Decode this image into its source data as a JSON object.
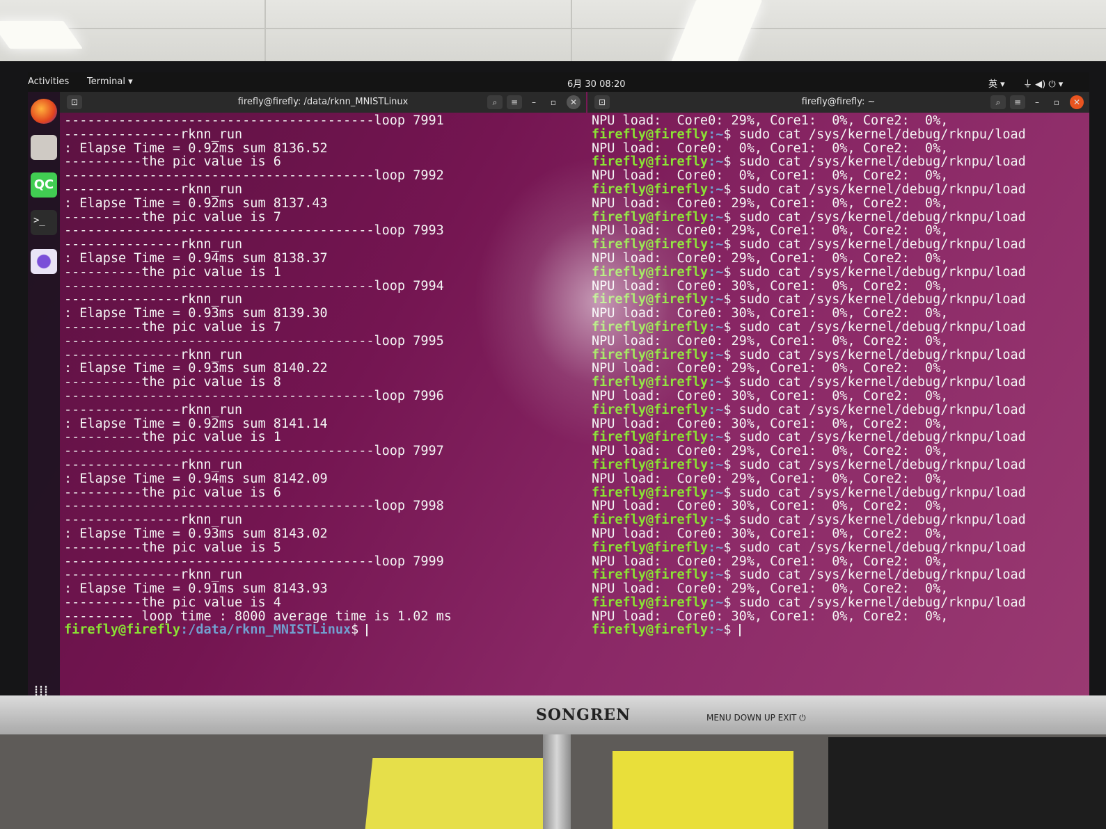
{
  "topbar": {
    "activities": "Activities",
    "terminal_menu": "Terminal ▾",
    "clock": "6月 30 08:20",
    "input_method": "英 ▾"
  },
  "left_terminal": {
    "title": "firefly@firefly: /data/rknn_MNISTLinux",
    "lines": [
      "----------------------------------------loop 7991",
      "---------------rknn_run",
      ": Elapse Time = 0.92ms sum 8136.52",
      "----------the pic value is 6",
      "----------------------------------------loop 7992",
      "---------------rknn_run",
      ": Elapse Time = 0.92ms sum 8137.43",
      "----------the pic value is 7",
      "----------------------------------------loop 7993",
      "---------------rknn_run",
      ": Elapse Time = 0.94ms sum 8138.37",
      "----------the pic value is 1",
      "----------------------------------------loop 7994",
      "---------------rknn_run",
      ": Elapse Time = 0.93ms sum 8139.30",
      "----------the pic value is 7",
      "----------------------------------------loop 7995",
      "---------------rknn_run",
      ": Elapse Time = 0.93ms sum 8140.22",
      "----------the pic value is 8",
      "----------------------------------------loop 7996",
      "---------------rknn_run",
      ": Elapse Time = 0.92ms sum 8141.14",
      "----------the pic value is 1",
      "----------------------------------------loop 7997",
      "---------------rknn_run",
      ": Elapse Time = 0.94ms sum 8142.09",
      "----------the pic value is 6",
      "----------------------------------------loop 7998",
      "---------------rknn_run",
      ": Elapse Time = 0.93ms sum 8143.02",
      "----------the pic value is 5",
      "----------------------------------------loop 7999",
      "---------------rknn_run",
      ": Elapse Time = 0.91ms sum 8143.93",
      "----------the pic value is 4",
      "--------- loop time : 8000 average time is 1.02 ms"
    ],
    "prompt_user": "firefly@firefly",
    "prompt_path": ":/data/rknn_MNISTLinux",
    "prompt_symbol": "$ "
  },
  "right_terminal": {
    "title": "firefly@firefly: ~",
    "first_line": "NPU load:  Core0: 29%, Core1:  0%, Core2:  0%,",
    "prompt_user": "firefly@firefly",
    "prompt_path": ":~",
    "prompt_symbol": "$ ",
    "command": "sudo cat /sys/kernel/debug/rknpu/load",
    "outputs": [
      "NPU load:  Core0:  0%, Core1:  0%, Core2:  0%,",
      "NPU load:  Core0:  0%, Core1:  0%, Core2:  0%,",
      "NPU load:  Core0: 29%, Core1:  0%, Core2:  0%,",
      "NPU load:  Core0: 29%, Core1:  0%, Core2:  0%,",
      "NPU load:  Core0: 29%, Core1:  0%, Core2:  0%,",
      "NPU load:  Core0: 30%, Core1:  0%, Core2:  0%,",
      "NPU load:  Core0: 30%, Core1:  0%, Core2:  0%,",
      "NPU load:  Core0: 29%, Core1:  0%, Core2:  0%,",
      "NPU load:  Core0: 29%, Core1:  0%, Core2:  0%,",
      "NPU load:  Core0: 30%, Core1:  0%, Core2:  0%,",
      "NPU load:  Core0: 30%, Core1:  0%, Core2:  0%,",
      "NPU load:  Core0: 29%, Core1:  0%, Core2:  0%,",
      "NPU load:  Core0: 29%, Core1:  0%, Core2:  0%,",
      "NPU load:  Core0: 30%, Core1:  0%, Core2:  0%,",
      "NPU load:  Core0: 30%, Core1:  0%, Core2:  0%,",
      "NPU load:  Core0: 29%, Core1:  0%, Core2:  0%,",
      "NPU load:  Core0: 29%, Core1:  0%, Core2:  0%,",
      "NPU load:  Core0: 30%, Core1:  0%, Core2:  0%,"
    ]
  },
  "monitor": {
    "brand": "SONGREN",
    "osd_buttons": "MENU  DOWN  UP    EXIT   ⏻"
  },
  "colors": {
    "prompt_user": "#8ae234",
    "prompt_path": "#729fcf",
    "wallpaper": "#741551"
  },
  "icons": {
    "dock": [
      "firefox-icon",
      "files-icon",
      "qtcreator-icon",
      "terminal-icon",
      "screenshot-icon",
      "app-grid-icon"
    ]
  }
}
